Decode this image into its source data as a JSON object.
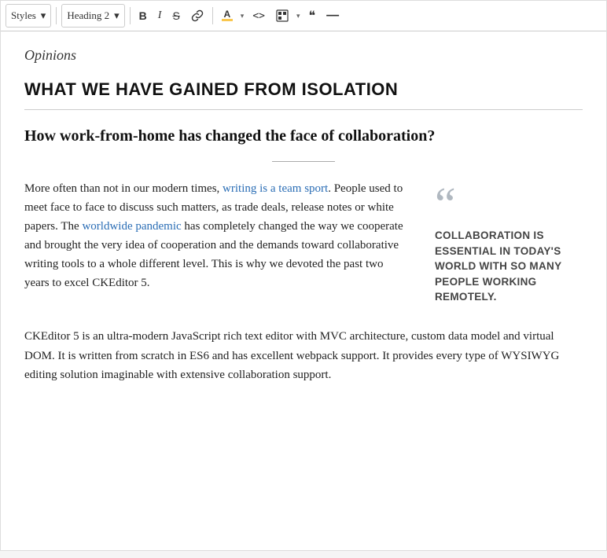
{
  "toolbar": {
    "styles_label": "Styles",
    "heading_label": "Heading 2",
    "bold_label": "B",
    "italic_label": "I",
    "strikethrough_label": "S",
    "link_label": "🔗",
    "highlight_label": "A",
    "code_label": "<>",
    "special_label": "⊞",
    "quote_label": "❝",
    "dash_label": "—"
  },
  "content": {
    "category": "Opinions",
    "title": "WHAT WE HAVE GAINED FROM ISOLATION",
    "subtitle": "How work-from-home has changed the face of collaboration?",
    "para1_before_link1": "More often than not in our modern times, ",
    "link1_text": "writing is a team sport",
    "link1_href": "#",
    "para1_after_link1": ". People used to meet face to face to discuss such matters, as trade deals, release notes or white papers. The ",
    "link2_text": "worldwide pandemic",
    "link2_href": "#",
    "para1_after_link2": " has completely changed the way we cooperate and brought the very idea of cooperation and the demands toward collaborative writing tools to a whole different level. This is why we devoted the past two years to excel CKEditor 5.",
    "pullquote_text": "COLLABORATION IS ESSENTIAL IN TODAY'S WORLD WITH SO MANY PEOPLE WORKING REMOTELY.",
    "para2": "CKEditor 5 is an ultra-modern JavaScript rich text editor with MVC architecture, custom data model and virtual DOM. It is written from scratch in ES6 and has excellent webpack support. It provides every type of WYSIWYG editing solution imaginable with extensive collaboration support."
  }
}
